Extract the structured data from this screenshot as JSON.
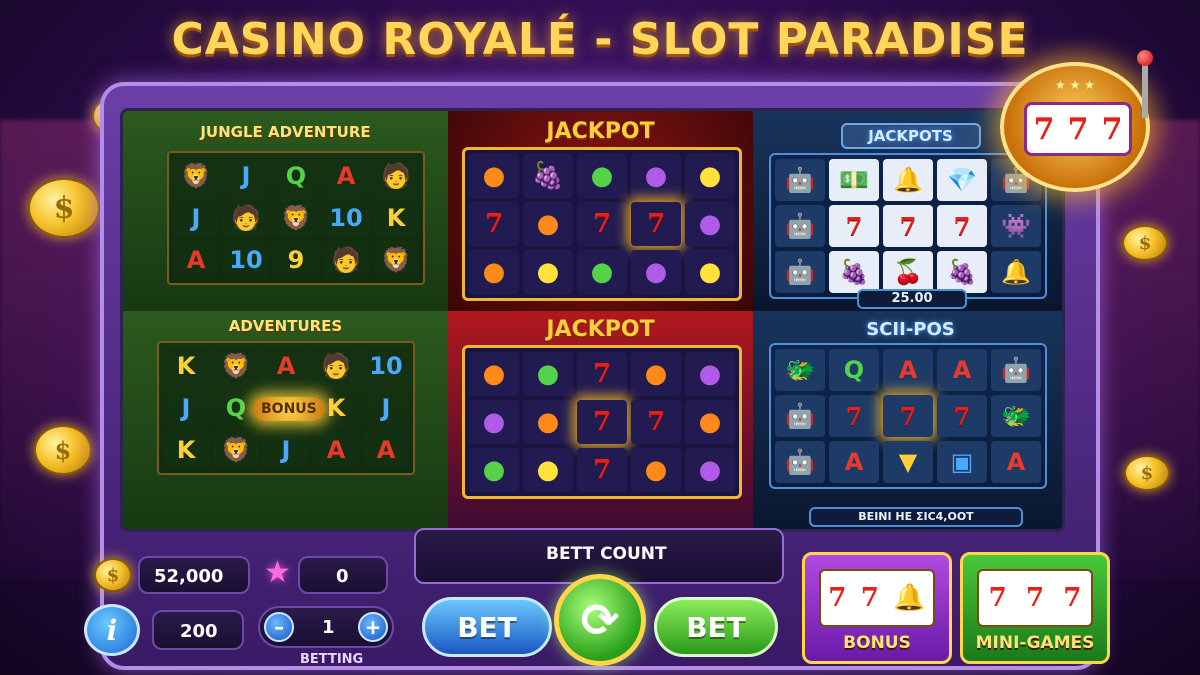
{
  "title": "CASINO ROYALÉ - SLOT PARADISE",
  "colors": {
    "accent_gold": "#ffd55a",
    "cabinet_purple": "#6b3fa8",
    "spin_green": "#2aa01a",
    "bet_blue": "#1a56c2"
  },
  "header_machine": {
    "reels": [
      "7",
      "7",
      "7"
    ],
    "icon": "slot-machine-icon"
  },
  "panels": {
    "jungle": {
      "title": "JUNGLE ADVENTURE",
      "reels": [
        [
          "lion",
          "J",
          "Q",
          "A",
          "explorer"
        ],
        [
          "J",
          "explorer",
          "lion",
          "10",
          "K"
        ],
        [
          "A",
          "10",
          "9",
          "explorer",
          "lion"
        ]
      ]
    },
    "jackpot_top": {
      "title": "JACKPOT",
      "reels": [
        [
          "orange",
          "grapes",
          "lime",
          "plum",
          "lemon"
        ],
        [
          "7",
          "orange",
          "7",
          "7",
          "plum"
        ],
        [
          "orange",
          "lemon",
          "lime",
          "plum",
          "lemon"
        ]
      ]
    },
    "scifi_top": {
      "title": "JACKPOTS",
      "value": "25.00",
      "reels": [
        [
          "robot",
          "cash",
          "bell",
          "diamond",
          "robot"
        ],
        [
          "robot",
          "7",
          "7",
          "7",
          "alien"
        ],
        [
          "robot",
          "grapes",
          "cherry",
          "grapes",
          "bell"
        ]
      ]
    },
    "adventures": {
      "title": "ADVENTURES",
      "bonus": "BONUS",
      "reels": [
        [
          "K",
          "lion",
          "A",
          "explorer",
          "10"
        ],
        [
          "J",
          "Q",
          "bonus",
          "K",
          "J"
        ],
        [
          "K",
          "lion",
          "J",
          "A",
          "A"
        ]
      ]
    },
    "jackpot_bottom": {
      "title": "JACKPOT",
      "reels": [
        [
          "orange",
          "lime",
          "7",
          "orange",
          "plum"
        ],
        [
          "plum",
          "orange",
          "7",
          "7",
          "grapefruit"
        ],
        [
          "lime",
          "lemon",
          "7",
          "orange",
          "plum"
        ]
      ]
    },
    "scifi_bottom": {
      "title": "SCII-POS",
      "footer": "BEINI HE ΣIC4,OOT",
      "reels": [
        [
          "beast",
          "Q",
          "A",
          "A",
          "robot"
        ],
        [
          "robot",
          "7",
          "7",
          "7",
          "beast"
        ],
        [
          "robot",
          "A",
          "gem",
          "capsule",
          "A"
        ]
      ]
    }
  },
  "controls": {
    "coins": "52,000",
    "stars": "0",
    "bet_amount": "200",
    "stepper_value": "1",
    "stepper_minus": "–",
    "stepper_plus": "+",
    "betting_label": "BETTING",
    "bet_count_label": "BETT COUNT",
    "bet_left": "BET",
    "bet_right": "BET",
    "info": "i",
    "coin_symbol": "$"
  },
  "mini_cards": {
    "bonus": {
      "label": "BONUS",
      "reels": [
        "7",
        "7",
        "bell"
      ]
    },
    "mini_games": {
      "label": "MINI-GAMES",
      "reels": [
        "7",
        "7",
        "7"
      ]
    }
  }
}
